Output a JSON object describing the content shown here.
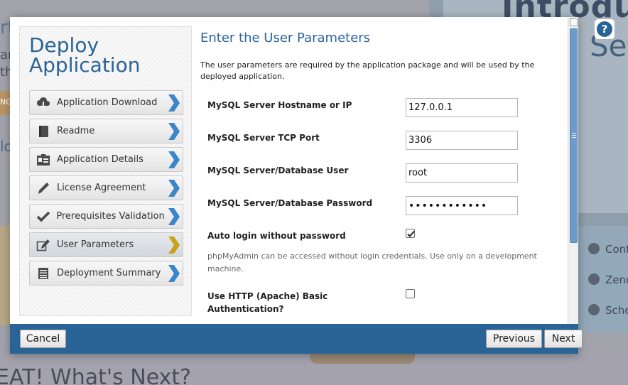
{
  "dialog": {
    "title": "Deploy Application",
    "title_line1": "Deploy",
    "title_line2": "Application",
    "steps": [
      {
        "label": "Application Download",
        "icon": "cloud-download-icon",
        "active": false
      },
      {
        "label": "Readme",
        "icon": "book-icon",
        "active": false
      },
      {
        "label": "Application Details",
        "icon": "id-card-icon",
        "active": false
      },
      {
        "label": "License Agreement",
        "icon": "pen-icon",
        "active": false
      },
      {
        "label": "Prerequisites Validation",
        "icon": "checkmark-icon",
        "active": false
      },
      {
        "label": "User Parameters",
        "icon": "edit-icon",
        "active": true
      },
      {
        "label": "Deployment Summary",
        "icon": "list-icon",
        "active": false
      }
    ],
    "content": {
      "title": "Enter the User Parameters",
      "description": "The user parameters are required by the application package and will be used by the deployed application.",
      "fields": {
        "hostname": {
          "label": "MySQL Server Hostname or IP",
          "value": "127.0.0.1"
        },
        "port": {
          "label": "MySQL Server TCP Port",
          "value": "3306"
        },
        "user": {
          "label": "MySQL Server/Database User",
          "value": "root"
        },
        "password": {
          "label": "MySQL Server/Database Password",
          "value": "••••••••••••"
        },
        "auto_login": {
          "label": "Auto login without password",
          "checked": true,
          "help": "phpMyAdmin can be accessed without login credentials. Use only on a development machine."
        },
        "http_auth": {
          "label_line1": "Use HTTP (Apache) Basic",
          "label_line2": "Authentication?",
          "checked": false
        }
      }
    },
    "buttons": {
      "cancel": "Cancel",
      "previous": "Previous",
      "next": "Next"
    }
  },
  "background": {
    "banner_title": "Introduc",
    "banner_sub": "Se",
    "left_heading": "rt",
    "left_text": "ar\nth",
    "left_label": "NG",
    "left_sub": "lo",
    "right_items": [
      "Cont",
      "Zend",
      "Sche"
    ],
    "bottom_heading": "EAT! What's Next?"
  },
  "colors": {
    "brand": "#2a6496",
    "footer": "#2a6496",
    "active_arrow": "#c9a21a",
    "arrow": "#3a86c8"
  }
}
